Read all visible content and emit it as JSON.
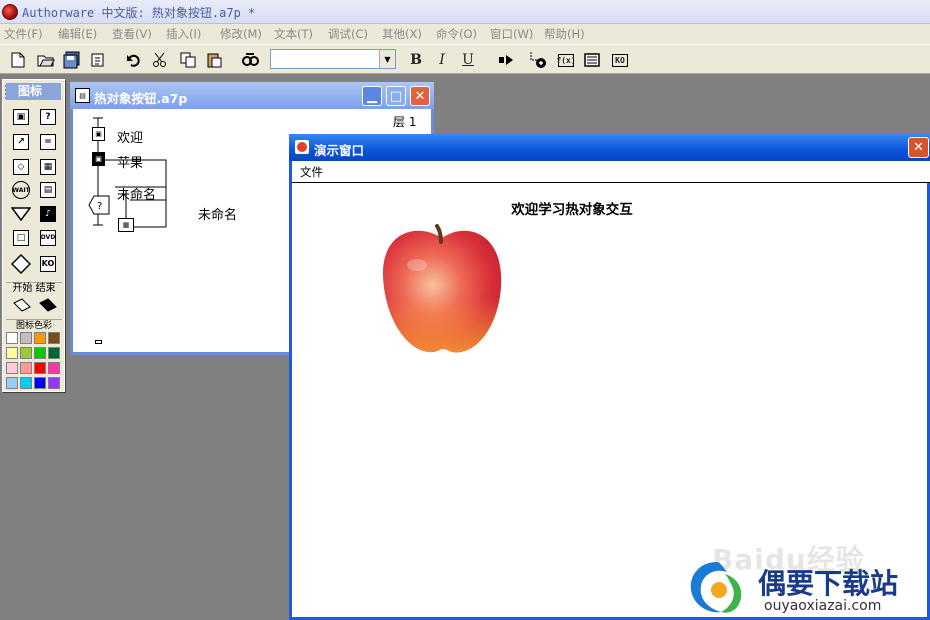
{
  "app": {
    "title": "Authorware 中文版: 热对象按钮.a7p *",
    "logo_icon": "authorware-logo-icon"
  },
  "menu": [
    "文件(F)",
    "编辑(E)",
    "查看(V)",
    "插入(I)",
    "修改(M)",
    "文本(T)",
    "调试(C)",
    "其他(X)",
    "命令(O)",
    "窗口(W)",
    "帮助(H)"
  ],
  "toolbar": {
    "buttons": [
      "new-file-icon",
      "open-file-icon",
      "save-all-icon",
      "import-icon",
      "undo-icon",
      "cut-icon",
      "copy-icon",
      "paste-icon",
      "find-icon"
    ],
    "font_select_value": "",
    "bold": "B",
    "italic": "I",
    "underline": "U",
    "right_buttons": [
      "run-icon",
      "control-panel-icon",
      "functions-icon",
      "variables-icon",
      "knowledge-objects-icon"
    ],
    "fn_label": "f(x)",
    "ko_label": "KO"
  },
  "palette": {
    "title": "图标",
    "start": "开始",
    "end": "结束",
    "color_title": "图标色彩",
    "icons": [
      "display-icon",
      "interaction-icon",
      "motion-icon",
      "calculation-icon",
      "erase-icon",
      "map-icon",
      "wait-icon",
      "digital-movie-icon",
      "navigate-icon",
      "sound-icon",
      "framework-icon",
      "video-icon",
      "decision-icon",
      "knowledge-object-icon"
    ],
    "wait_label": "WAIT",
    "dvd_label": "DVD",
    "ko_label": "KO",
    "colors": [
      "#ffffff",
      "#c0c0c0",
      "#ff9900",
      "#7a4a1a",
      "#ffff99",
      "#99cc33",
      "#00cc00",
      "#006633",
      "#ffccdd",
      "#ff9999",
      "#ff0000",
      "#ff33aa",
      "#99ccff",
      "#00ccff",
      "#0000ff",
      "#9933ff"
    ]
  },
  "flow_window": {
    "title": "热对象按钮.a7p",
    "level_label": "层 1",
    "icons": [
      {
        "label": "欢迎"
      },
      {
        "label": "苹果"
      },
      {
        "label": "未命名"
      }
    ],
    "response_label": "未命名"
  },
  "presentation_window": {
    "title": "演示窗口",
    "menu_file": "文件",
    "heading": "欢迎学习热对象交互"
  },
  "watermark": {
    "baidu": "Baidu经验",
    "site_name": "偶要下载站",
    "site_url": "ouyaoxiazai.com"
  }
}
